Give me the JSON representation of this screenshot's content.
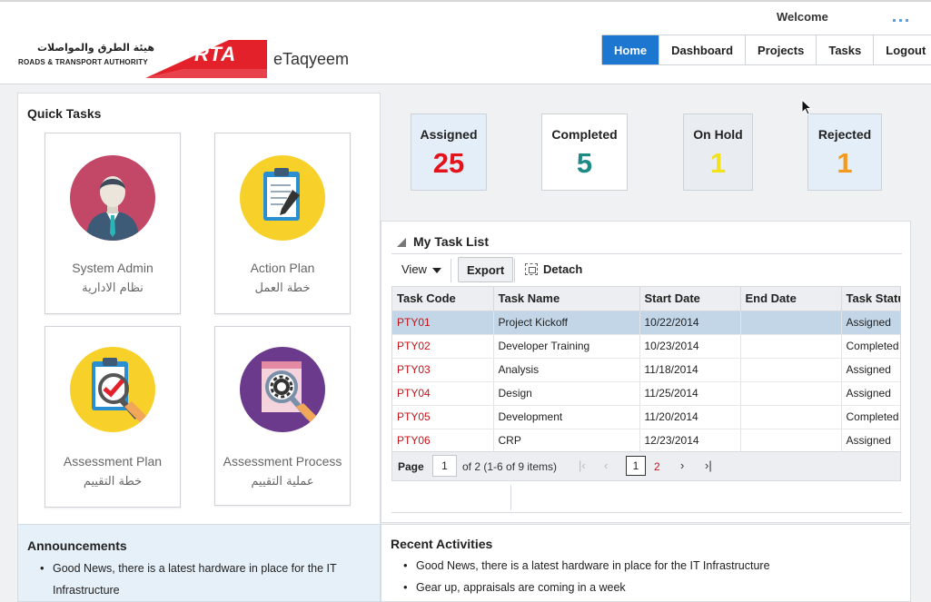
{
  "header": {
    "logo_ar": "هيئة الطرق والمواصلات",
    "logo_en": "ROADS & TRANSPORT AUTHORITY",
    "logo_rta": "RTA",
    "app_name": "eTaqyeem",
    "welcome": "Welcome"
  },
  "nav": [
    "Home",
    "Dashboard",
    "Projects",
    "Tasks",
    "Logout"
  ],
  "quick_tasks": {
    "title": "Quick Tasks",
    "items": [
      {
        "en": "System Admin",
        "ar": "نظام الادارية",
        "icon": "admin-user-icon"
      },
      {
        "en": "Action Plan",
        "ar": "خطة العمل",
        "icon": "clipboard-pen-icon"
      },
      {
        "en": "Assessment Plan",
        "ar": "خطة التقييم",
        "icon": "clipboard-check-icon"
      },
      {
        "en": "Assessment Process",
        "ar": "عملية التقييم",
        "icon": "document-gear-icon"
      }
    ]
  },
  "stats": [
    {
      "label": "Assigned",
      "value": "25",
      "color": "#e3121b",
      "bg": "#e4eef8"
    },
    {
      "label": "Completed",
      "value": "5",
      "color": "#1e8a86",
      "bg": "#ffffff"
    },
    {
      "label": "On Hold",
      "value": "1",
      "color": "#f2e21c",
      "bg": "#e9edf1"
    },
    {
      "label": "Rejected",
      "value": "1",
      "color": "#f39a1e",
      "bg": "#e4eef8"
    }
  ],
  "task_list": {
    "title": "My Task List",
    "view_label": "View",
    "export_label": "Export",
    "detach_label": "Detach",
    "columns": [
      "Task Code",
      "Task Name",
      "Start Date",
      "End Date",
      "Task Status"
    ],
    "rows": [
      [
        "PTY01",
        "Project Kickoff",
        "10/22/2014",
        "",
        "Assigned"
      ],
      [
        "PTY02",
        "Developer Training",
        "10/23/2014",
        "",
        "Completed"
      ],
      [
        "PTY03",
        "Analysis",
        "11/18/2014",
        "",
        "Assigned"
      ],
      [
        "PTY04",
        "Design",
        "11/25/2014",
        "",
        "Assigned"
      ],
      [
        "PTY05",
        "Development",
        "11/20/2014",
        "",
        "Completed"
      ],
      [
        "PTY06",
        "CRP",
        "12/23/2014",
        "",
        "Assigned"
      ]
    ],
    "pager": {
      "label": "Page",
      "current": "1",
      "of_text": "of 2  (1-6 of 9 items)",
      "page_current": "1",
      "page_next": "2"
    }
  },
  "announcements": {
    "title": "Announcements",
    "items": [
      "Good News, there is a latest hardware in place for the IT Infrastructure"
    ]
  },
  "recent_activities": {
    "title": "Recent Activities",
    "items": [
      "Good News, there is a latest hardware in place for the IT Infrastructure",
      "Gear up, appraisals are coming in a week"
    ]
  }
}
